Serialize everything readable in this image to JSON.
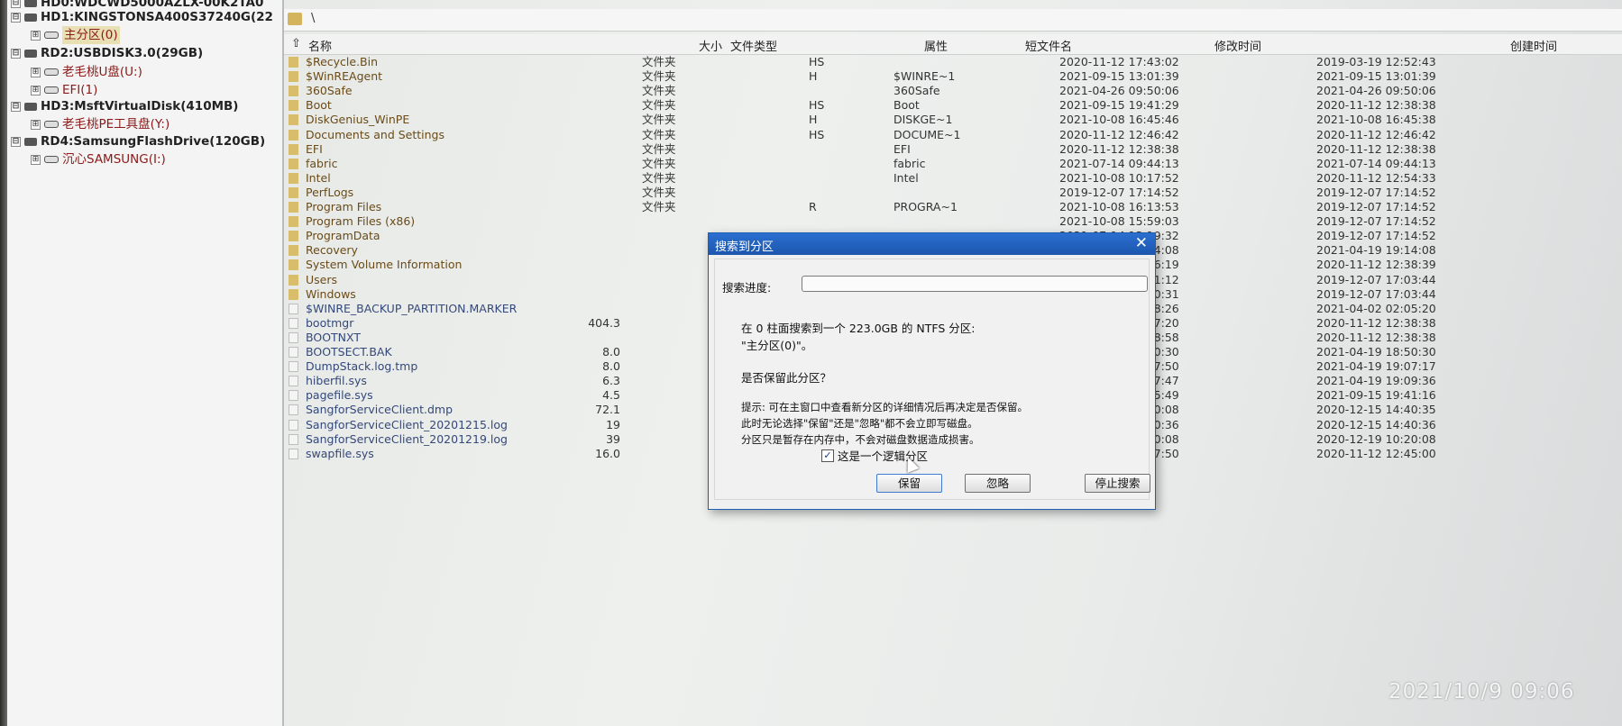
{
  "colors": {
    "title_bar": "#1c56ad",
    "folder_icon": "#d8bd6a",
    "partition_text": "#8b1a1a",
    "progress_fill": "#2fae45"
  },
  "tree": {
    "items": [
      {
        "label": "HD0:WDCWD5000AZLX-00K2TA0",
        "kind": "disk",
        "expander": "⊟",
        "icon": "hard-disk-icon"
      },
      {
        "label": "HD1:KINGSTONSA400S37240G(22",
        "kind": "disk",
        "expander": "⊟",
        "icon": "hard-disk-icon"
      },
      {
        "label": "主分区(0)",
        "kind": "part",
        "expander": "⊞",
        "icon": "partition-icon",
        "selected": true
      },
      {
        "label": "RD2:USBDISK3.0(29GB)",
        "kind": "disk",
        "expander": "⊟",
        "icon": "hard-disk-icon"
      },
      {
        "label": "老毛桃U盘(U:)",
        "kind": "part",
        "expander": "⊞",
        "icon": "partition-icon"
      },
      {
        "label": "EFI(1)",
        "kind": "part",
        "expander": "⊞",
        "icon": "partition-icon"
      },
      {
        "label": "HD3:MsftVirtualDisk(410MB)",
        "kind": "disk",
        "expander": "⊟",
        "icon": "hard-disk-icon"
      },
      {
        "label": "老毛桃PE工具盘(Y:)",
        "kind": "part",
        "expander": "⊞",
        "icon": "partition-icon"
      },
      {
        "label": "RD4:SamsungFlashDrive(120GB)",
        "kind": "disk",
        "expander": "⊟",
        "icon": "hard-disk-icon"
      },
      {
        "label": "沉心SAMSUNG(I:)",
        "kind": "part",
        "expander": "⊞",
        "icon": "partition-icon"
      }
    ]
  },
  "path": {
    "text": "\\"
  },
  "columns": {
    "sort_arrow": "⇧",
    "name": "名称",
    "size": "大小",
    "type": "文件类型",
    "attr": "属性",
    "short_name": "短文件名",
    "modified": "修改时间",
    "created": "创建时间"
  },
  "files": [
    {
      "name": "$Recycle.Bin",
      "kind": "folder",
      "size": "",
      "type": "文件夹",
      "attr": "HS",
      "short": "",
      "modified": "2020-11-12 17:43:02",
      "created": "2019-03-19 12:52:43"
    },
    {
      "name": "$WinREAgent",
      "kind": "folder",
      "size": "",
      "type": "文件夹",
      "attr": "H",
      "short": "$WINRE~1",
      "modified": "2021-09-15 13:01:39",
      "created": "2021-09-15 13:01:39"
    },
    {
      "name": "360Safe",
      "kind": "folder",
      "size": "",
      "type": "文件夹",
      "attr": "",
      "short": "360Safe",
      "modified": "2021-04-26 09:50:06",
      "created": "2021-04-26 09:50:06"
    },
    {
      "name": "Boot",
      "kind": "folder",
      "size": "",
      "type": "文件夹",
      "attr": "HS",
      "short": "Boot",
      "modified": "2021-09-15 19:41:29",
      "created": "2020-11-12 12:38:38"
    },
    {
      "name": "DiskGenius_WinPE",
      "kind": "folder",
      "size": "",
      "type": "文件夹",
      "attr": "H",
      "short": "DISKGE~1",
      "modified": "2021-10-08 16:45:46",
      "created": "2021-10-08 16:45:38"
    },
    {
      "name": "Documents and Settings",
      "kind": "folder",
      "size": "",
      "type": "文件夹",
      "attr": "HS",
      "short": "DOCUME~1",
      "modified": "2020-11-12 12:46:42",
      "created": "2020-11-12 12:46:42"
    },
    {
      "name": "EFI",
      "kind": "folder",
      "size": "",
      "type": "文件夹",
      "attr": "",
      "short": "EFI",
      "modified": "2020-11-12 12:38:38",
      "created": "2020-11-12 12:38:38"
    },
    {
      "name": "fabric",
      "kind": "folder",
      "size": "",
      "type": "文件夹",
      "attr": "",
      "short": "fabric",
      "modified": "2021-07-14 09:44:13",
      "created": "2021-07-14 09:44:13"
    },
    {
      "name": "Intel",
      "kind": "folder",
      "size": "",
      "type": "文件夹",
      "attr": "",
      "short": "Intel",
      "modified": "2021-10-08 10:17:52",
      "created": "2020-11-12 12:54:33"
    },
    {
      "name": "PerfLogs",
      "kind": "folder",
      "size": "",
      "type": "文件夹",
      "attr": "",
      "short": "",
      "modified": "2019-12-07 17:14:52",
      "created": "2019-12-07 17:14:52"
    },
    {
      "name": "Program Files",
      "kind": "folder",
      "size": "",
      "type": "文件夹",
      "attr": "R",
      "short": "PROGRA~1",
      "modified": "2021-10-08 16:13:53",
      "created": "2019-12-07 17:14:52"
    },
    {
      "name": "Program Files (x86)",
      "kind": "folder",
      "size": "",
      "type": "",
      "attr": "",
      "short": "",
      "modified": "2021-10-08 15:59:03",
      "created": "2019-12-07 17:14:52"
    },
    {
      "name": "ProgramData",
      "kind": "folder",
      "size": "",
      "type": "",
      "attr": "",
      "short": "",
      "modified": "2021-07-14 13:19:32",
      "created": "2019-12-07 17:14:52"
    },
    {
      "name": "Recovery",
      "kind": "folder",
      "size": "",
      "type": "",
      "attr": "",
      "short": "",
      "modified": "2021-04-19 19:14:08",
      "created": "2021-04-19 19:14:08"
    },
    {
      "name": "System Volume Information",
      "kind": "folder",
      "size": "",
      "type": "",
      "attr": "",
      "short": "",
      "modified": "2021-07-14 14:16:19",
      "created": "2020-11-12 12:38:39"
    },
    {
      "name": "Users",
      "kind": "folder",
      "size": "",
      "type": "",
      "attr": "",
      "short": "",
      "modified": "2021-07-14 14:21:12",
      "created": "2019-12-07 17:03:44"
    },
    {
      "name": "Windows",
      "kind": "folder",
      "size": "",
      "type": "",
      "attr": "",
      "short": "",
      "modified": "2021-09-15 19:40:31",
      "created": "2019-12-07 17:03:44"
    },
    {
      "name": "$WINRE_BACKUP_PARTITION.MARKER",
      "kind": "file",
      "size": "",
      "type": "",
      "attr": "",
      "short": "",
      "modified": "2021-04-14 01:58:26",
      "created": "2021-04-02 02:05:20"
    },
    {
      "name": "bootmgr",
      "kind": "file",
      "size": "404.3",
      "type": "",
      "attr": "",
      "short": "",
      "modified": "2021-09-15 13:07:20",
      "created": "2020-11-12 12:38:38"
    },
    {
      "name": "BOOTNXT",
      "kind": "file",
      "size": "",
      "type": "",
      "attr": "",
      "short": "",
      "modified": "2019-12-07 17:08:58",
      "created": "2020-11-12 12:38:38"
    },
    {
      "name": "BOOTSECT.BAK",
      "kind": "file",
      "size": "8.0",
      "type": "",
      "attr": "",
      "short": "",
      "modified": "2021-04-19 18:50:30",
      "created": "2021-04-19 18:50:30"
    },
    {
      "name": "DumpStack.log.tmp",
      "kind": "file",
      "size": "8.0",
      "type": "",
      "attr": "",
      "short": "",
      "modified": "2021-10-08 10:17:50",
      "created": "2021-04-19 19:07:17"
    },
    {
      "name": "hiberfil.sys",
      "kind": "file",
      "size": "6.3",
      "type": "",
      "attr": "",
      "short": "",
      "modified": "2021-10-08 10:17:47",
      "created": "2021-04-19 19:09:36"
    },
    {
      "name": "pagefile.sys",
      "kind": "file",
      "size": "4.5",
      "type": "",
      "attr": "",
      "short": "",
      "modified": "2021-10-08 16:45:49",
      "created": "2021-09-15 19:41:16"
    },
    {
      "name": "SangforServiceClient.dmp",
      "kind": "file",
      "size": "72.1",
      "type": "",
      "attr": "",
      "short": "",
      "modified": "2020-12-19 10:20:08",
      "created": "2020-12-15 14:40:35"
    },
    {
      "name": "SangforServiceClient_20201215.log",
      "kind": "file",
      "size": "19",
      "type": "",
      "attr": "",
      "short": "",
      "modified": "2020-12-15 14:40:36",
      "created": "2020-12-15 14:40:36"
    },
    {
      "name": "SangforServiceClient_20201219.log",
      "kind": "file",
      "size": "39",
      "type": "",
      "attr": "",
      "short": "",
      "modified": "2020-12-19 10:20:08",
      "created": "2020-12-19 10:20:08"
    },
    {
      "name": "swapfile.sys",
      "kind": "file",
      "size": "16.0",
      "type": "",
      "attr": "",
      "short": "",
      "modified": "2021-10-08 10:17:50",
      "created": "2020-11-12 12:45:00"
    }
  ],
  "dialog": {
    "title": "搜索到分区",
    "close": "✕",
    "progress_label": "搜索进度:",
    "progress_percent": 0,
    "found_line1": "在 0 柱面搜索到一个 223.0GB 的 NTFS 分区:",
    "found_line2": "\"主分区(0)\"。",
    "question": "是否保留此分区？",
    "hint_line1": "提示: 可在主窗口中查看新分区的详细情况后再决定是否保留。",
    "hint_line2": "此时无论选择\"保留\"还是\"忽略\"都不会立即写磁盘。",
    "hint_line3": "分区只是暂存在内存中，不会对磁盘数据造成损害。",
    "checkbox_label": "这是一个逻辑分区",
    "checkbox_checked": true,
    "checkbox_mark": "✓",
    "keep_button": "保留",
    "ignore_button": "忽略",
    "stop_button": "停止搜索"
  },
  "overlay": {
    "timestamp": "2021/10/9 09:06"
  }
}
